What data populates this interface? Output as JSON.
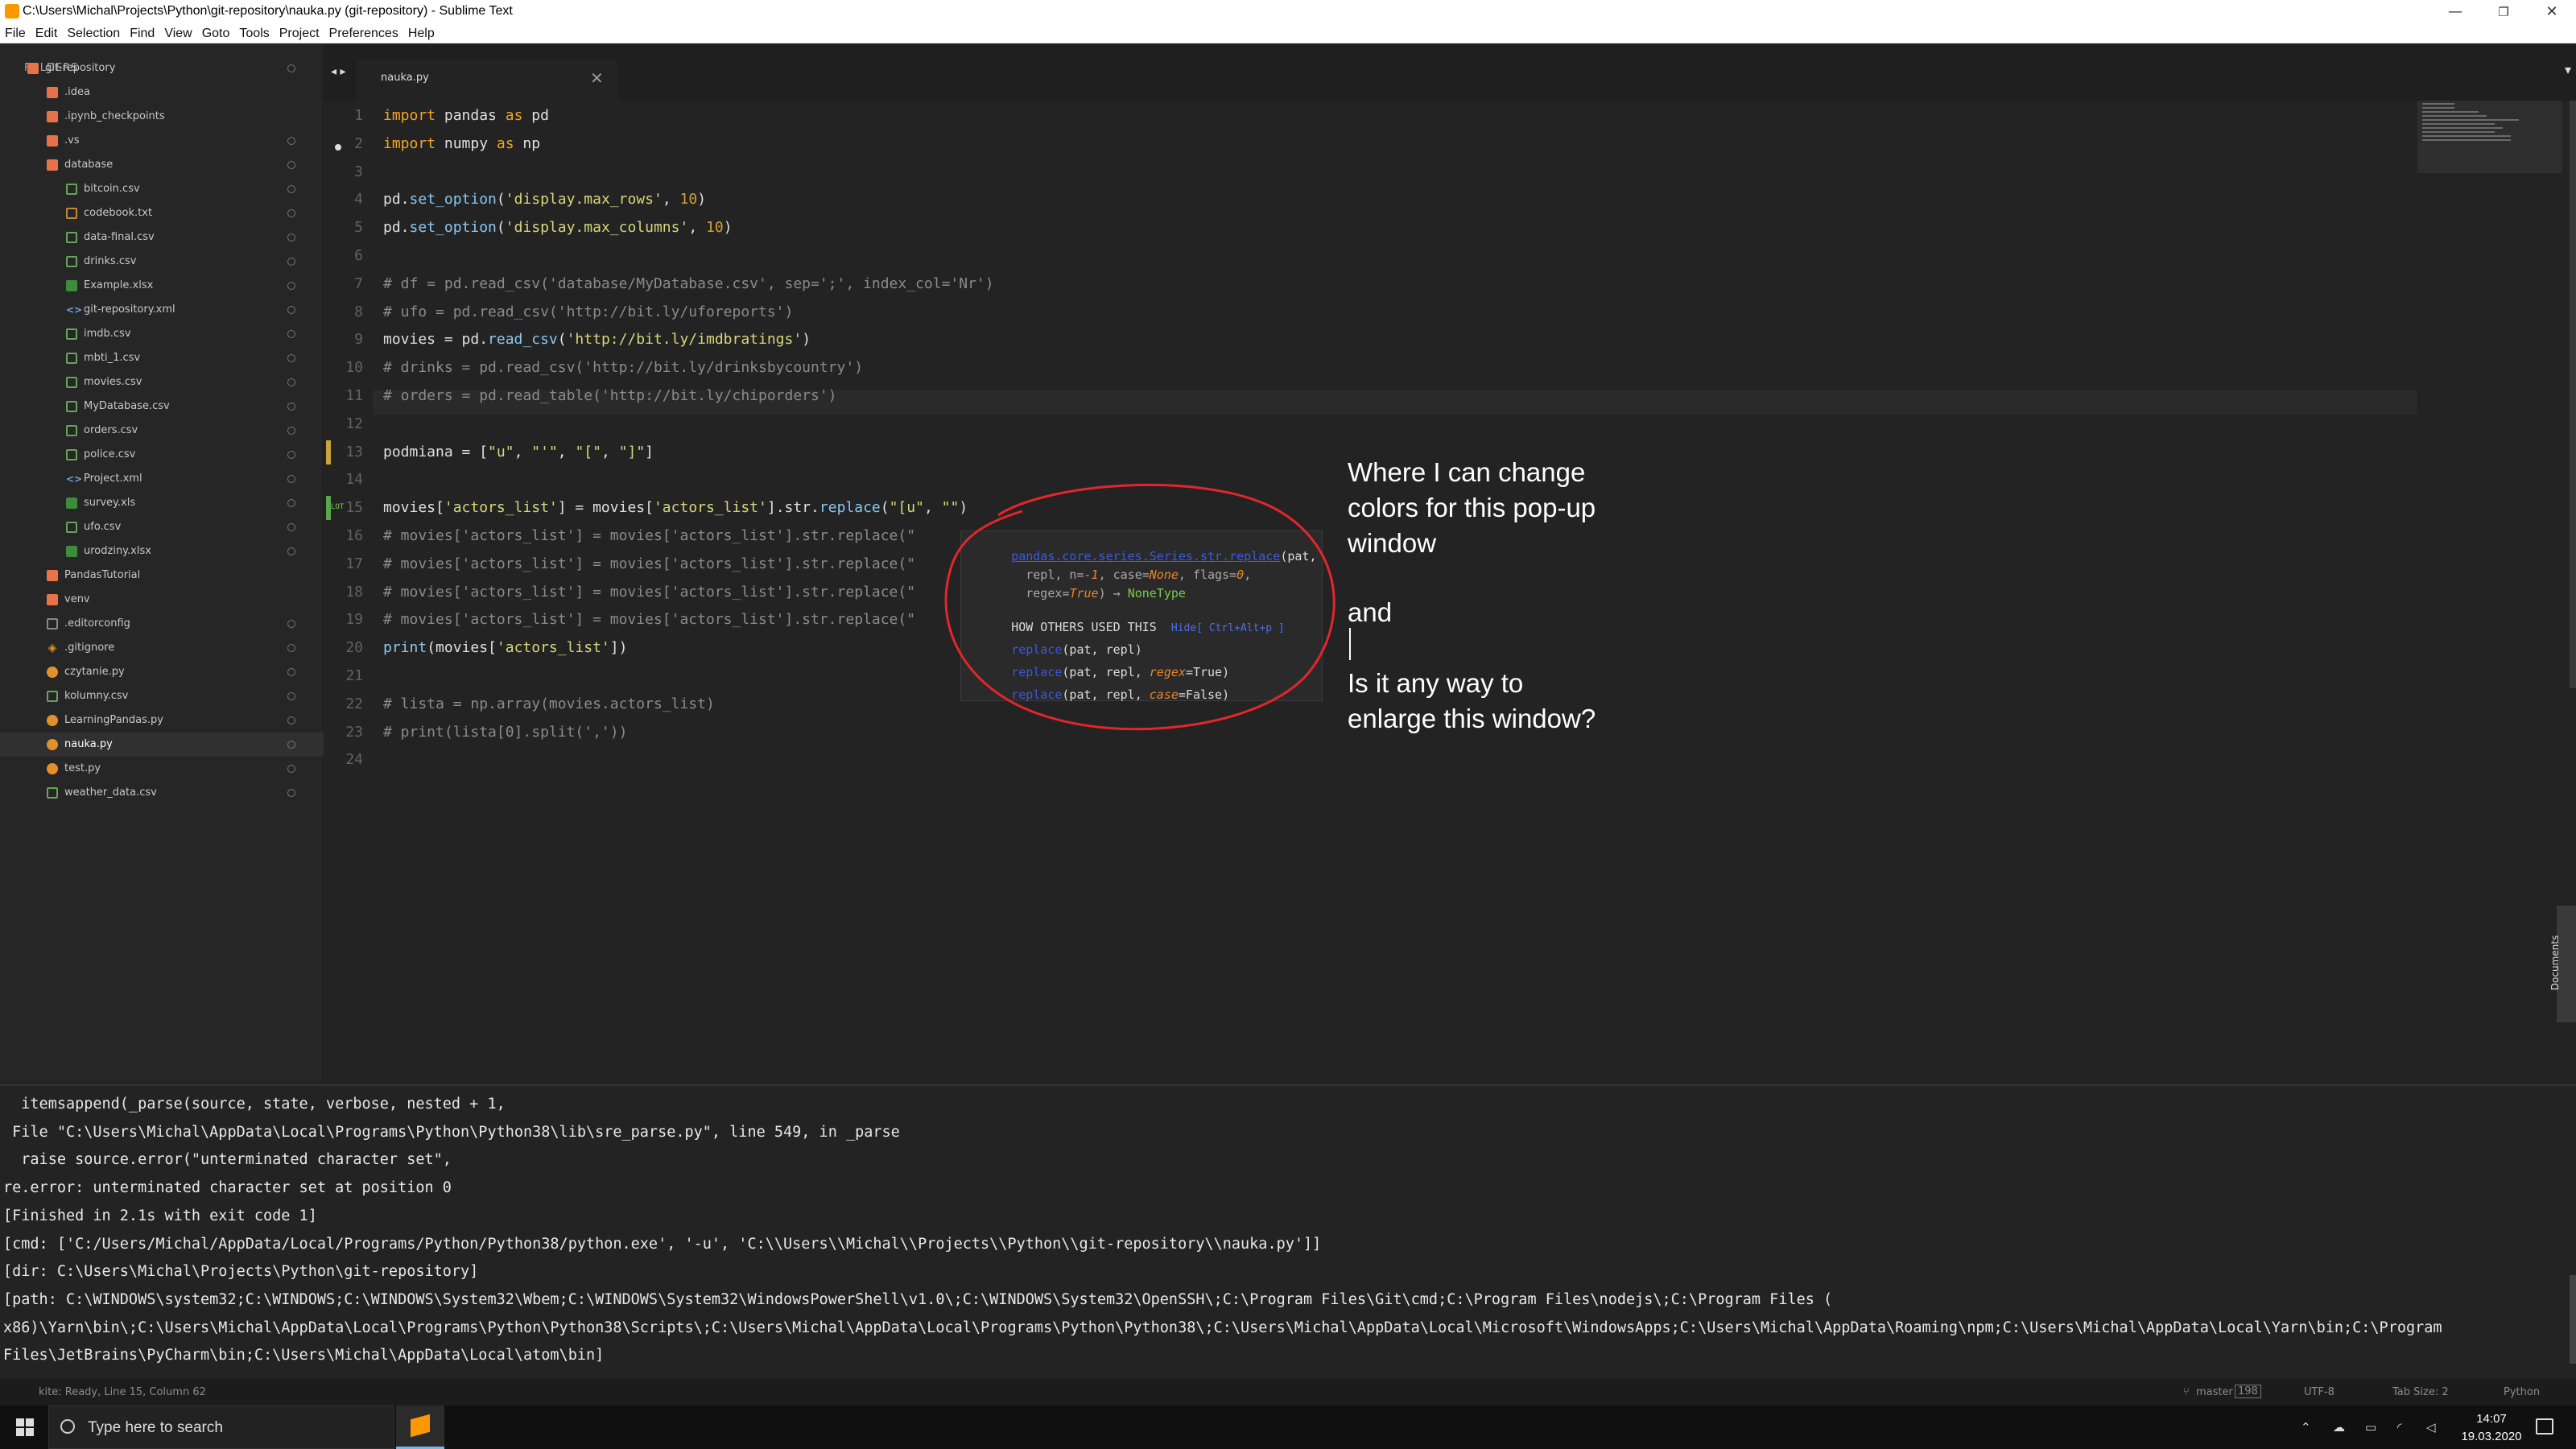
{
  "window": {
    "title": "C:\\Users\\Michal\\Projects\\Python\\git-repository\\nauka.py (git-repository) - Sublime Text",
    "minimize": "—",
    "restore": "❐",
    "close": "✕"
  },
  "menu": [
    "File",
    "Edit",
    "Selection",
    "Find",
    "View",
    "Goto",
    "Tools",
    "Project",
    "Preferences",
    "Help"
  ],
  "sidebar": {
    "header": "FOLDERS",
    "items": [
      {
        "label": "git-repository",
        "icon": "folder-open-icon",
        "indent": 0
      },
      {
        "label": ".idea",
        "icon": "folder-icon",
        "indent": 1
      },
      {
        "label": ".ipynb_checkpoints",
        "icon": "folder-icon",
        "indent": 1
      },
      {
        "label": ".vs",
        "icon": "folder-icon",
        "indent": 1
      },
      {
        "label": "database",
        "icon": "folder-open-icon",
        "indent": 1
      },
      {
        "label": "bitcoin.csv",
        "icon": "csv-file-icon",
        "indent": 2
      },
      {
        "label": "codebook.txt",
        "icon": "text-file-icon",
        "indent": 2
      },
      {
        "label": "data-final.csv",
        "icon": "csv-file-icon",
        "indent": 2
      },
      {
        "label": "drinks.csv",
        "icon": "csv-file-icon",
        "indent": 2
      },
      {
        "label": "Example.xlsx",
        "icon": "excel-file-icon",
        "indent": 2
      },
      {
        "label": "git-repository.xml",
        "icon": "xml-file-icon",
        "indent": 2
      },
      {
        "label": "imdb.csv",
        "icon": "csv-file-icon",
        "indent": 2
      },
      {
        "label": "mbti_1.csv",
        "icon": "csv-file-icon",
        "indent": 2
      },
      {
        "label": "movies.csv",
        "icon": "csv-file-icon",
        "indent": 2
      },
      {
        "label": "MyDatabase.csv",
        "icon": "csv-file-icon",
        "indent": 2
      },
      {
        "label": "orders.csv",
        "icon": "csv-file-icon",
        "indent": 2
      },
      {
        "label": "police.csv",
        "icon": "csv-file-icon",
        "indent": 2
      },
      {
        "label": "Project.xml",
        "icon": "xml-file-icon",
        "indent": 2
      },
      {
        "label": "survey.xls",
        "icon": "excel-file-icon",
        "indent": 2
      },
      {
        "label": "ufo.csv",
        "icon": "csv-file-icon",
        "indent": 2
      },
      {
        "label": "urodziny.xlsx",
        "icon": "excel-file-icon",
        "indent": 2
      },
      {
        "label": "PandasTutorial",
        "icon": "folder-icon",
        "indent": 1
      },
      {
        "label": "venv",
        "icon": "folder-icon",
        "indent": 1
      },
      {
        "label": ".editorconfig",
        "icon": "config-file-icon",
        "indent": 1
      },
      {
        "label": ".gitignore",
        "icon": "git-file-icon",
        "indent": 1
      },
      {
        "label": "czytanie.py",
        "icon": "python-file-icon",
        "indent": 1
      },
      {
        "label": "kolumny.csv",
        "icon": "csv-file-icon",
        "indent": 1
      },
      {
        "label": "LearningPandas.py",
        "icon": "python-file-icon",
        "indent": 1
      },
      {
        "label": "nauka.py",
        "icon": "python-file-icon",
        "indent": 1,
        "active": true
      },
      {
        "label": "test.py",
        "icon": "python-file-icon",
        "indent": 1
      },
      {
        "label": "weather_data.csv",
        "icon": "csv-file-icon",
        "indent": 1
      }
    ]
  },
  "tabs": {
    "nav_arrows": "◂ ▸",
    "active_tab": "nauka.py",
    "close": "✕",
    "dropdown": "▾"
  },
  "editor": {
    "lines": [
      {
        "n": "1",
        "html": "<span class=\"kw\">import</span> pandas <span class=\"kw\">as</span> pd"
      },
      {
        "n": "2",
        "html": "<span class=\"kw\">import</span> numpy <span class=\"kw\">as</span> np"
      },
      {
        "n": "3",
        "html": ""
      },
      {
        "n": "4",
        "html": "pd.<span class=\"fn\">set_option</span>(<span class=\"str\">'display.max_rows'</span>, <span class=\"num\">10</span>)"
      },
      {
        "n": "5",
        "html": "pd.<span class=\"fn\">set_option</span>(<span class=\"str\">'display.max_columns'</span>, <span class=\"num\">10</span>)"
      },
      {
        "n": "6",
        "html": ""
      },
      {
        "n": "7",
        "comment": true,
        "text": "# df = pd.read_csv('database/MyDatabase.csv', sep=';', index_col='Nr')"
      },
      {
        "n": "8",
        "comment": true,
        "text": "# ufo = pd.read_csv('http://bit.ly/uforeports')"
      },
      {
        "n": "9",
        "html": "movies = pd.<span class=\"fn\">read_csv</span>(<span class=\"str\">'http://bit.ly/imdbratings'</span>)"
      },
      {
        "n": "10",
        "comment": true,
        "text": "# drinks = pd.read_csv('http://bit.ly/drinksbycountry')"
      },
      {
        "n": "11",
        "comment": true,
        "text": "# orders = pd.read_table('http://bit.ly/chiporders')"
      },
      {
        "n": "12",
        "html": ""
      },
      {
        "n": "13",
        "html": "podmiana = [<span class=\"str\">\"u\"</span>, <span class=\"str\">\"'\"</span>, <span class=\"str\">\"[\"</span>, <span class=\"str\">\"]\"</span>]"
      },
      {
        "n": "14",
        "html": ""
      },
      {
        "n": "15",
        "html": "movies[<span class=\"str\">'actors_list'</span>] = movies[<span class=\"str\">'actors_list'</span>].str.<span class=\"fn\">replace</span>(<span class=\"str\">\"[u\"</span>, <span class=\"str\">\"\"</span>)"
      },
      {
        "n": "16",
        "comment": true,
        "text": "# movies['actors_list'] = movies['actors_list'].str.replace(\""
      },
      {
        "n": "17",
        "comment": true,
        "text": "# movies['actors_list'] = movies['actors_list'].str.replace(\""
      },
      {
        "n": "18",
        "comment": true,
        "text": "# movies['actors_list'] = movies['actors_list'].str.replace(\""
      },
      {
        "n": "19",
        "comment": true,
        "text": "# movies['actors_list'] = movies['actors_list'].str.replace(\""
      },
      {
        "n": "20",
        "html": "<span class=\"fn\">print</span>(movies[<span class=\"str\">'actors_list'</span>])"
      },
      {
        "n": "21",
        "html": ""
      },
      {
        "n": "22",
        "comment": true,
        "text": "# lista = np.array(movies.actors_list)"
      },
      {
        "n": "23",
        "comment": true,
        "text": "# print(lista[0].split(','))"
      },
      {
        "n": "24",
        "html": ""
      }
    ],
    "gutter_badge": "LOT"
  },
  "popup": {
    "sig_name": "pandas.core.series.Series.str.replace",
    "sig_rest1": "(pat,",
    "line2_a": "  repl, n=",
    "line2_b": "-1",
    "line2_c": ", case=",
    "line2_d": "None",
    "line2_e": ", flags=",
    "line2_f": "0",
    "line2_g": ",",
    "line3_a": "  regex=",
    "line3_b": "True",
    "line3_c": ") → ",
    "line3_d": "NoneType",
    "others_label": "HOW OTHERS USED THIS",
    "others_hint": "Hide[ Ctrl+Alt+p ]",
    "u1_fn": "replace",
    "u1_args": "(pat, repl)",
    "u2_fn": "replace",
    "u2_a": "(pat, repl, ",
    "u2_b": "regex",
    "u2_c": "=True)",
    "u3_fn": "replace",
    "u3_a": "(pat, repl, ",
    "u3_b": "case",
    "u3_c": "=False)"
  },
  "annotation": {
    "p1": "Where I can change\ncolors for this pop-up\nwindow",
    "p2": "and",
    "p3": "Is it any way to\nenlarge this window?"
  },
  "doc_tab": "Documents",
  "output": [
    "  itemsappend(_parse(source, state, verbose, nested + 1,",
    " File \"C:\\Users\\Michal\\AppData\\Local\\Programs\\Python\\Python38\\lib\\sre_parse.py\", line 549, in _parse",
    "  raise source.error(\"unterminated character set\",",
    "re.error: unterminated character set at position 0",
    "[Finished in 2.1s with exit code 1]",
    "[cmd: ['C:/Users/Michal/AppData/Local/Programs/Python/Python38/python.exe', '-u', 'C:\\\\Users\\\\Michal\\\\Projects\\\\Python\\\\git-repository\\\\nauka.py']]",
    "[dir: C:\\Users\\Michal\\Projects\\Python\\git-repository]",
    "[path: C:\\WINDOWS\\system32;C:\\WINDOWS;C:\\WINDOWS\\System32\\Wbem;C:\\WINDOWS\\System32\\WindowsPowerShell\\v1.0\\;C:\\WINDOWS\\System32\\OpenSSH\\;C:\\Program Files\\Git\\cmd;C:\\Program Files\\nodejs\\;C:\\Program Files (",
    "x86)\\Yarn\\bin\\;C:\\Users\\Michal\\AppData\\Local\\Programs\\Python\\Python38\\Scripts\\;C:\\Users\\Michal\\AppData\\Local\\Programs\\Python\\Python38\\;C:\\Users\\Michal\\AppData\\Local\\Microsoft\\WindowsApps;C:\\Users\\Michal\\AppData\\Roaming\\npm;C:\\Users\\Michal\\AppData\\Local\\Yarn\\bin;C:\\Program",
    "Files\\JetBrains\\PyCharm\\bin;C:\\Users\\Michal\\AppData\\Local\\atom\\bin]"
  ],
  "status": {
    "left": "kite: Ready, Line 15, Column 62",
    "branch": "master",
    "branch_count": "198",
    "encoding": "UTF-8",
    "tab_size": "Tab Size: 2",
    "syntax": "Python"
  },
  "taskbar": {
    "search_placeholder": "Type here to search",
    "time": "14:07",
    "date": "19.03.2020"
  }
}
